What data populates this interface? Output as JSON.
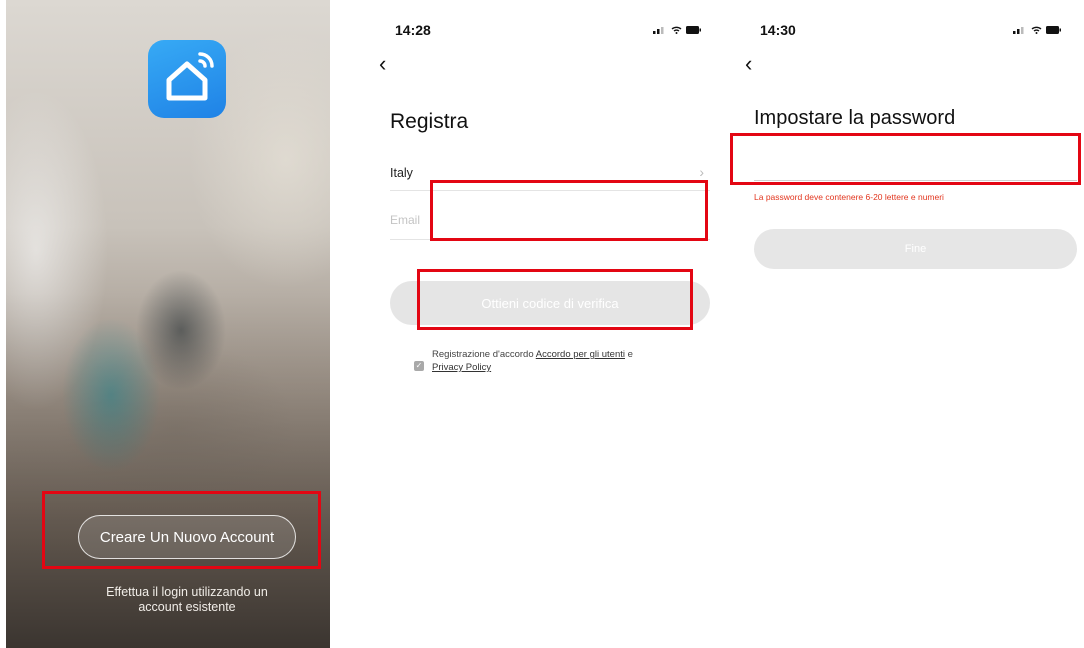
{
  "welcome": {
    "create_account_label": "Creare Un Nuovo Account",
    "login_line1": "Effettua il login utilizzando un",
    "login_line2": "account esistente"
  },
  "register": {
    "time": "14:28",
    "title": "Registra",
    "country": "Italy",
    "email_placeholder": "Email",
    "verify_button": "Ottieni codice di verifica",
    "agree_prefix": "Registrazione d'accordo",
    "terms_link": "Accordo per gli utenti",
    "agree_and": "e",
    "privacy_link": "Privacy Policy"
  },
  "password": {
    "time": "14:30",
    "title": "Impostare la password",
    "hint": "La password deve contenere 6-20 lettere e numeri",
    "finish_button": "Fine"
  },
  "icons": {
    "back": "chevron-left-icon",
    "signal": "signal-icon",
    "wifi": "wifi-icon",
    "battery": "battery-icon",
    "country_chevron": "chevron-right-icon",
    "app_logo": "smart-home-icon",
    "checkbox": "checkbox-checked-icon"
  },
  "colors": {
    "highlight": "#e30613",
    "app_blue": "#2a94ee",
    "error_text": "#e2361f",
    "button_disabled": "#e5e5e5"
  }
}
